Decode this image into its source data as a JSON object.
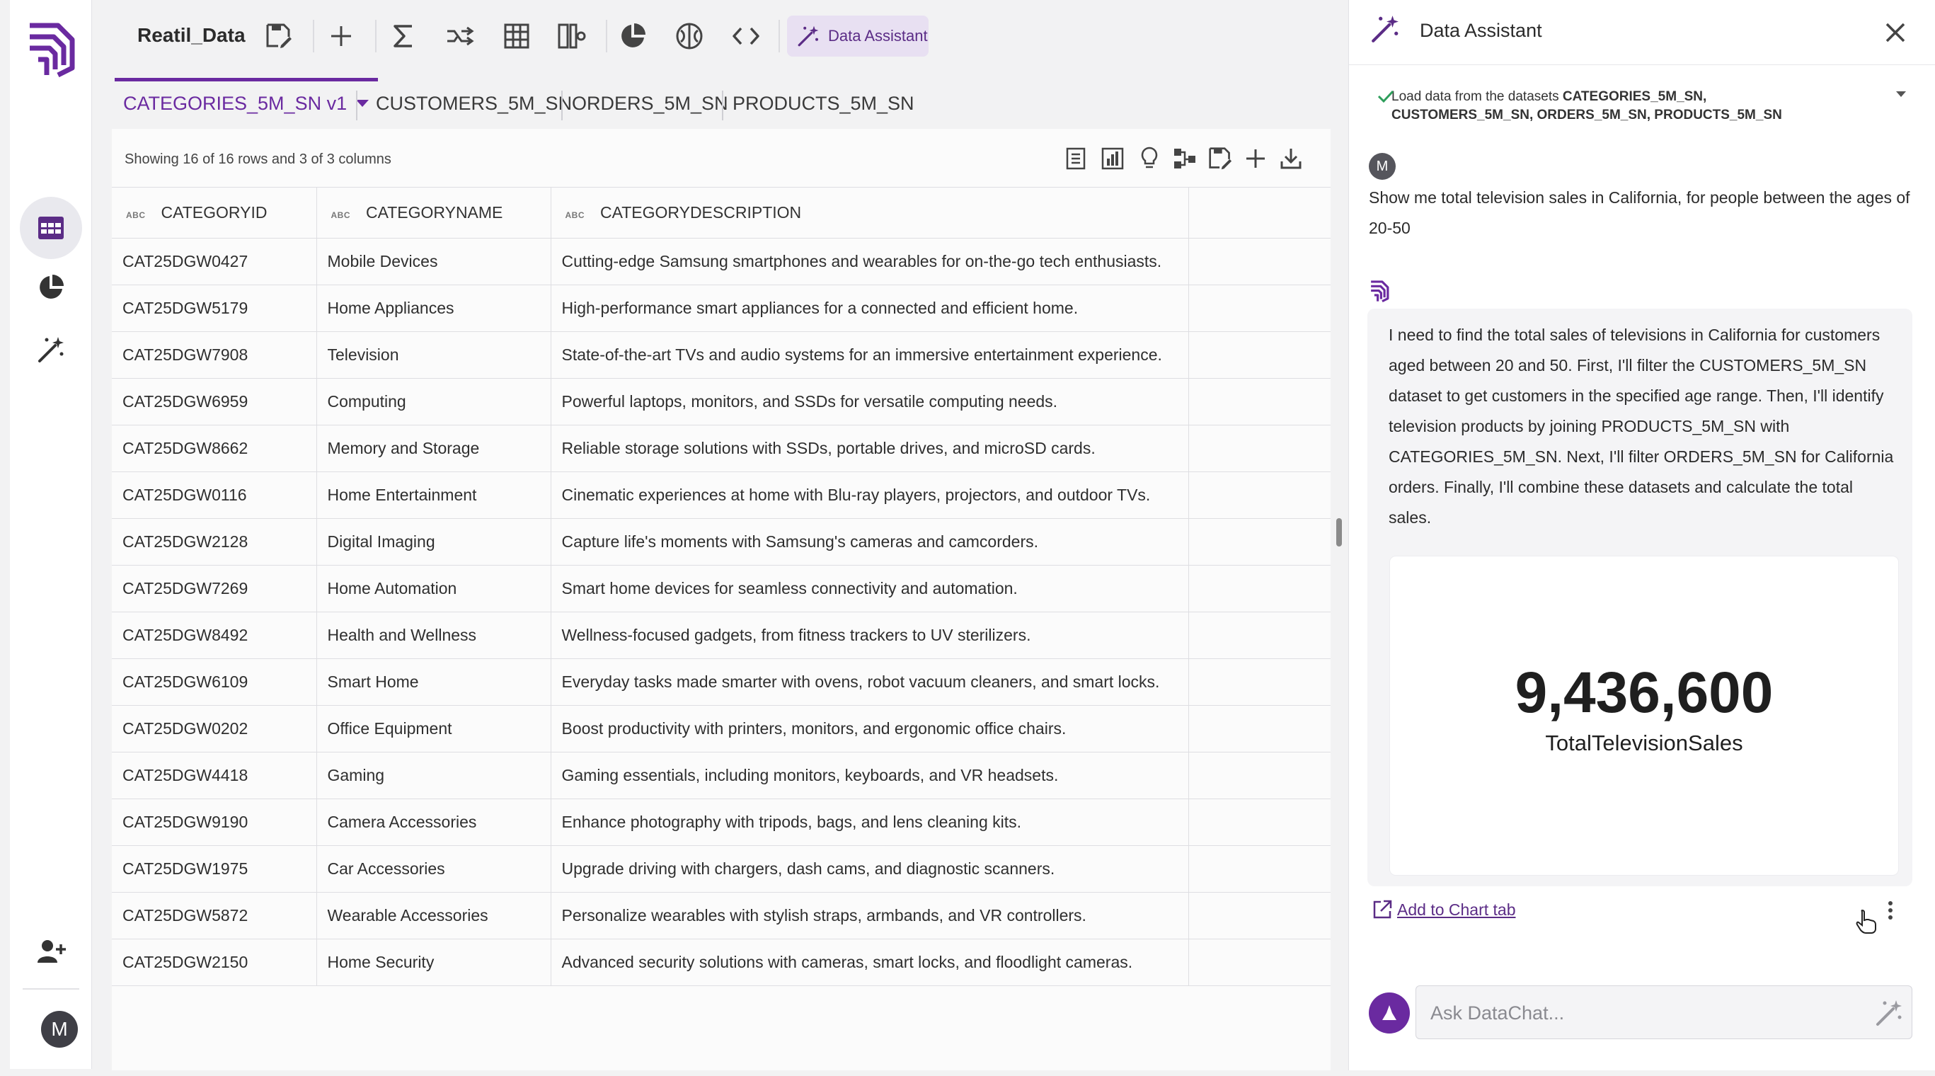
{
  "app": {
    "file_title": "Reatil_Data",
    "assistant_button_label": "Data Assistant"
  },
  "toolbar": {
    "icons": [
      "save-as-icon",
      "add-icon",
      "sigma-icon",
      "shuffle-icon",
      "grid-icon",
      "split-column-icon",
      "pie-chart-icon",
      "brain-icon",
      "code-icon",
      "magic-wand-icon"
    ]
  },
  "sidebar": {
    "items": [
      "table-icon",
      "pie-chart-icon",
      "magic-wand-icon",
      "add-user-icon"
    ],
    "avatar_initial": "M"
  },
  "tabs": [
    {
      "label": "CATEGORIES_5M_SN v1",
      "active": true
    },
    {
      "label": "CUSTOMERS_5M_SN",
      "active": false
    },
    {
      "label": "ORDERS_5M_SN",
      "active": false
    },
    {
      "label": "PRODUCTS_5M_SN",
      "active": false
    }
  ],
  "grid": {
    "summary": "Showing 16 of 16 rows and 3 of 3 columns",
    "type_badge": "ABC",
    "columns": [
      "CATEGORYID",
      "CATEGORYNAME",
      "CATEGORYDESCRIPTION"
    ],
    "rows": [
      [
        "CAT25DGW0427",
        "Mobile Devices",
        "Cutting-edge Samsung smartphones and wearables for on-the-go tech enthusiasts."
      ],
      [
        "CAT25DGW5179",
        "Home Appliances",
        "High-performance smart appliances for a connected and efficient home."
      ],
      [
        "CAT25DGW7908",
        "Television",
        "State-of-the-art TVs and audio systems for an immersive entertainment experience."
      ],
      [
        "CAT25DGW6959",
        "Computing",
        "Powerful laptops, monitors, and SSDs for versatile computing needs."
      ],
      [
        "CAT25DGW8662",
        "Memory and Storage",
        "Reliable storage solutions with SSDs, portable drives, and microSD cards."
      ],
      [
        "CAT25DGW0116",
        "Home Entertainment",
        "Cinematic experiences at home with Blu-ray players, projectors, and outdoor TVs."
      ],
      [
        "CAT25DGW2128",
        "Digital Imaging",
        "Capture life's moments with Samsung's cameras and camcorders."
      ],
      [
        "CAT25DGW7269",
        "Home Automation",
        "Smart home devices for seamless connectivity and automation."
      ],
      [
        "CAT25DGW8492",
        "Health and Wellness",
        "Wellness-focused gadgets, from fitness trackers to UV sterilizers."
      ],
      [
        "CAT25DGW6109",
        "Smart Home",
        "Everyday tasks made smarter with ovens, robot vacuum cleaners, and smart locks."
      ],
      [
        "CAT25DGW0202",
        "Office Equipment",
        "Boost productivity with printers, monitors, and ergonomic office chairs."
      ],
      [
        "CAT25DGW4418",
        "Gaming",
        "Gaming essentials, including monitors, keyboards, and VR headsets."
      ],
      [
        "CAT25DGW9190",
        "Camera Accessories",
        "Enhance photography with tripods, bags, and lens cleaning kits."
      ],
      [
        "CAT25DGW1975",
        "Car Accessories",
        "Upgrade driving with chargers, dash cams, and diagnostic scanners."
      ],
      [
        "CAT25DGW5872",
        "Wearable Accessories",
        "Personalize wearables with stylish straps, armbands, and VR controllers."
      ],
      [
        "CAT25DGW2150",
        "Home Security",
        "Advanced security solutions with cameras, smart locks, and floodlight cameras."
      ]
    ]
  },
  "assistant": {
    "title": "Data Assistant",
    "step_prefix": "Load data from the datasets ",
    "step_datasets_1": "CATEGORIES_5M_SN,",
    "step_datasets_2": "CUSTOMERS_5M_SN, ORDERS_5M_SN, PRODUCTS_5M_SN",
    "user_initial": "M",
    "user_message": "Show me total television sales in California, for people between the ages of 20-50",
    "bot_message": "I need to find the total sales of televisions in California for customers aged between 20 and 50. First, I'll filter the CUSTOMERS_5M_SN dataset to get customers in the specified age range. Then, I'll identify television products by joining PRODUCTS_5M_SN with CATEGORIES_5M_SN. Next, I'll filter ORDERS_5M_SN for California orders. Finally, I'll combine these datasets and calculate the total sales.",
    "kpi_value": "9,436,600",
    "kpi_label": "TotalTelevisionSales",
    "add_to_chart_label": "Add to Chart tab",
    "input_placeholder": "Ask DataChat..."
  },
  "colors": {
    "accent": "#6a2aa0",
    "accent_light": "#e8e0f2"
  }
}
